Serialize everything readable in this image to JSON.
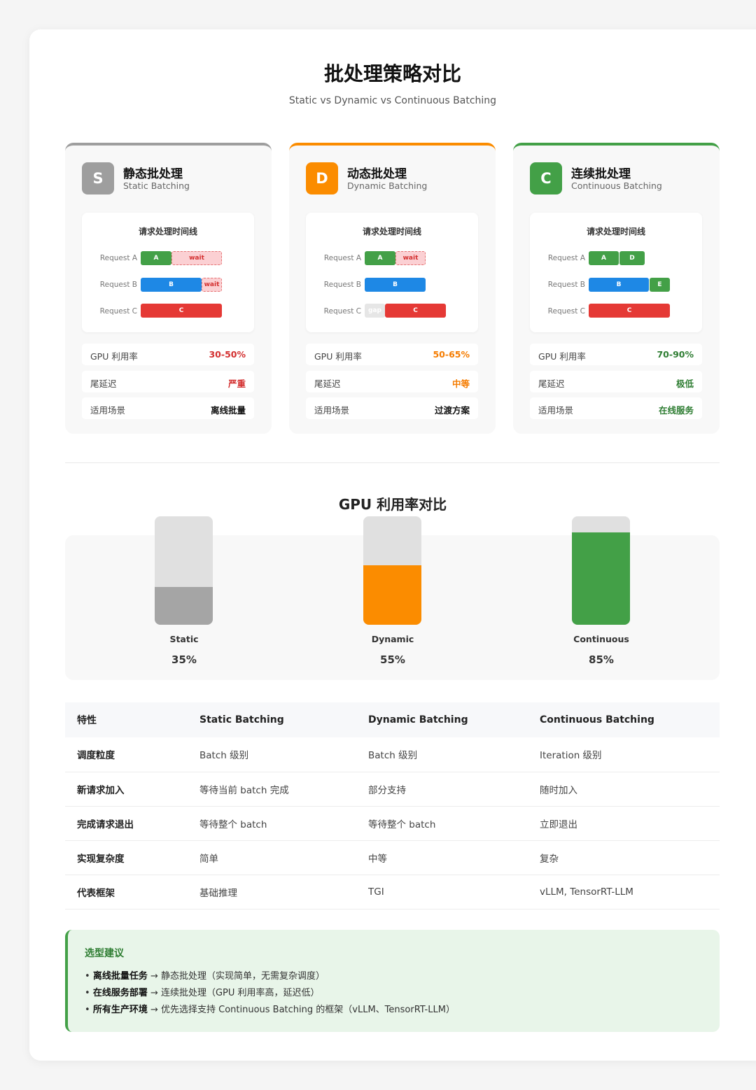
{
  "header": {
    "title": "批处理策略对比",
    "subtitle": "Static vs Dynamic vs Continuous Batching"
  },
  "colors": {
    "static": "#9e9e9e",
    "dynamic": "#fb8c00",
    "continuous": "#43a047",
    "blue": "#1e88e5",
    "red": "#e53935"
  },
  "cards": [
    {
      "badge": "S",
      "title": "静态批处理",
      "subtitle": "Static Batching",
      "timeline_title": "请求处理时间线",
      "rows": [
        {
          "label": "Request A",
          "segments": [
            {
              "text": "A"
            },
            {
              "text": "wait"
            }
          ]
        },
        {
          "label": "Request B",
          "segments": [
            {
              "text": "B"
            },
            {
              "text": "wait"
            }
          ]
        },
        {
          "label": "Request C",
          "segments": [
            {
              "text": "C"
            }
          ]
        }
      ],
      "metrics": [
        {
          "label": "GPU 利用率",
          "value": "30-50%"
        },
        {
          "label": "尾延迟",
          "value": "严重"
        },
        {
          "label": "适用场景",
          "value": "离线批量"
        }
      ]
    },
    {
      "badge": "D",
      "title": "动态批处理",
      "subtitle": "Dynamic Batching",
      "timeline_title": "请求处理时间线",
      "rows": [
        {
          "label": "Request A",
          "segments": [
            {
              "text": "A"
            },
            {
              "text": "wait"
            }
          ]
        },
        {
          "label": "Request B",
          "segments": [
            {
              "text": "B"
            }
          ]
        },
        {
          "label": "Request C",
          "segments": [
            {
              "text": "gap"
            },
            {
              "text": "C"
            }
          ]
        }
      ],
      "metrics": [
        {
          "label": "GPU 利用率",
          "value": "50-65%"
        },
        {
          "label": "尾延迟",
          "value": "中等"
        },
        {
          "label": "适用场景",
          "value": "过渡方案"
        }
      ]
    },
    {
      "badge": "C",
      "title": "连续批处理",
      "subtitle": "Continuous Batching",
      "timeline_title": "请求处理时间线",
      "rows": [
        {
          "label": "Request A",
          "segments": [
            {
              "text": "A"
            },
            {
              "text": "D"
            }
          ]
        },
        {
          "label": "Request B",
          "segments": [
            {
              "text": "B"
            },
            {
              "text": "E"
            }
          ]
        },
        {
          "label": "Request C",
          "segments": [
            {
              "text": "C"
            }
          ]
        }
      ],
      "metrics": [
        {
          "label": "GPU 利用率",
          "value": "70-90%"
        },
        {
          "label": "尾延迟",
          "value": "极低"
        },
        {
          "label": "适用场景",
          "value": "在线服务"
        }
      ]
    }
  ],
  "gpu_section": {
    "title": "GPU 利用率对比",
    "bars": [
      {
        "name": "Static",
        "percent_label": "35%",
        "percent": 35
      },
      {
        "name": "Dynamic",
        "percent_label": "55%",
        "percent": 55
      },
      {
        "name": "Continuous",
        "percent_label": "85%",
        "percent": 85
      }
    ]
  },
  "table": {
    "headers": [
      "特性",
      "Static Batching",
      "Dynamic Batching",
      "Continuous Batching"
    ],
    "rows": [
      [
        "调度粒度",
        "Batch 级别",
        "Batch 级别",
        "Iteration 级别"
      ],
      [
        "新请求加入",
        "等待当前 batch 完成",
        "部分支持",
        "随时加入"
      ],
      [
        "完成请求退出",
        "等待整个 batch",
        "等待整个 batch",
        "立即退出"
      ],
      [
        "实现复杂度",
        "简单",
        "中等",
        "复杂"
      ],
      [
        "代表框架",
        "基础推理",
        "TGI",
        "vLLM, TensorRT-LLM"
      ]
    ]
  },
  "advice": {
    "title": "选型建议",
    "items": [
      {
        "bold": "离线批量任务",
        "rest": " → 静态批处理（实现简单，无需复杂调度）"
      },
      {
        "bold": "在线服务部署",
        "rest": " → 连续批处理（GPU 利用率高，延迟低）"
      },
      {
        "bold": "所有生产环境",
        "rest": " → 优先选择支持 Continuous Batching 的框架（vLLM、TensorRT-LLM）"
      }
    ],
    "bullet": "•"
  }
}
